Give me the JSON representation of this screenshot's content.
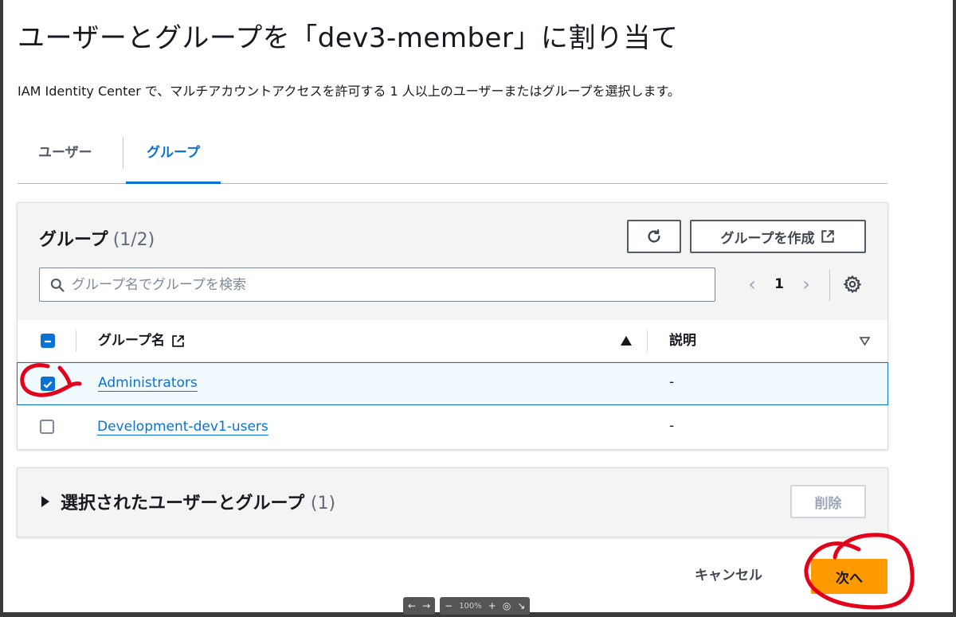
{
  "dialog": {
    "title": "ユーザーとグループを「dev3-member」に割り当て",
    "subtitle": "IAM Identity Center で、マルチアカウントアクセスを許可する 1 人以上のユーザーまたはグループを選択します。"
  },
  "tabs": [
    {
      "label": "ユーザー",
      "active": false
    },
    {
      "label": "グループ",
      "active": true
    }
  ],
  "groups_panel": {
    "title": "グループ",
    "count": "(1/2)",
    "create_label": "グループを作成",
    "search_placeholder": "グループ名でグループを検索",
    "page": "1",
    "columns": {
      "name": "グループ名",
      "description": "説明"
    },
    "rows": [
      {
        "name": "Administrators",
        "description": "-",
        "checked": true
      },
      {
        "name": "Development-dev1-users",
        "description": "-",
        "checked": false
      }
    ]
  },
  "selected_section": {
    "title": "選択されたユーザーとグループ",
    "count": "(1)",
    "delete_label": "削除"
  },
  "footer": {
    "cancel_label": "キャンセル",
    "next_label": "次へ"
  },
  "viewer": {
    "zoom": "100%"
  },
  "colors": {
    "accent": "#0972d3",
    "primary_button": "#ff9900",
    "annotation": "#e3001b"
  }
}
